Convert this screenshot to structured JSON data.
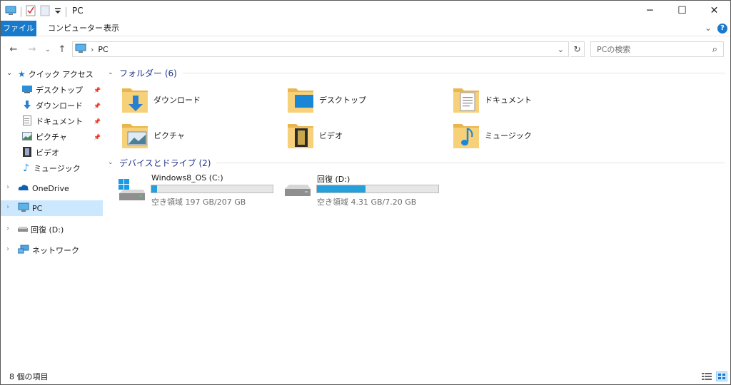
{
  "window": {
    "title": "PC",
    "minimize_glyph": "─",
    "maximize_glyph": "☐",
    "close_glyph": "✕"
  },
  "ribbon": {
    "tabs": [
      {
        "label": "ファイル"
      },
      {
        "label": "コンピューター"
      },
      {
        "label": "表示"
      }
    ],
    "collapse_glyph": "⌄",
    "help_glyph": "?"
  },
  "address": {
    "back_glyph": "←",
    "forward_glyph": "→",
    "recent_glyph": "⌄",
    "up_glyph": "↑",
    "crumb_sep": "›",
    "path": "PC",
    "dropdown_glyph": "⌄",
    "refresh_glyph": "↻",
    "search_placeholder": "PCの検索",
    "search_glyph": "⌕"
  },
  "nav": {
    "quick_access": {
      "label": "クイック アクセス",
      "chevron": "⌄"
    },
    "pinned": [
      {
        "label": "デスクトップ",
        "pin": "📌"
      },
      {
        "label": "ダウンロード",
        "pin": "📌"
      },
      {
        "label": "ドキュメント",
        "pin": "📌"
      },
      {
        "label": "ピクチャ",
        "pin": "📌"
      },
      {
        "label": "ビデオ"
      },
      {
        "label": "ミュージック"
      }
    ],
    "onedrive": {
      "label": "OneDrive",
      "chevron": "›"
    },
    "pc": {
      "label": "PC",
      "chevron": "›"
    },
    "drive_d": {
      "label": "回復 (D:)",
      "chevron": "›"
    },
    "network": {
      "label": "ネットワーク",
      "chevron": "›"
    }
  },
  "folders_group": {
    "label": "フォルダー (6)",
    "caret": "⌄"
  },
  "folders": [
    {
      "label": "ダウンロード",
      "icon": "download-folder"
    },
    {
      "label": "デスクトップ",
      "icon": "desktop-folder"
    },
    {
      "label": "ドキュメント",
      "icon": "documents-folder"
    },
    {
      "label": "ピクチャ",
      "icon": "pictures-folder"
    },
    {
      "label": "ビデオ",
      "icon": "videos-folder"
    },
    {
      "label": "ミュージック",
      "icon": "music-folder"
    }
  ],
  "drives_group": {
    "label": "デバイスとドライブ (2)",
    "caret": "⌄"
  },
  "drives": [
    {
      "label": "Windows8_OS (C:)",
      "free": "空き領域 197 GB/207 GB",
      "used_fraction": 0.048
    },
    {
      "label": "回復 (D:)",
      "free": "空き領域 4.31 GB/7.20 GB",
      "used_fraction": 0.4
    }
  ],
  "status": {
    "item_count": "8 個の項目"
  },
  "colors": {
    "accent": "#1979ca",
    "selection": "#cce8ff",
    "bar_fill": "#26a0da",
    "group_header": "#1e3287"
  }
}
